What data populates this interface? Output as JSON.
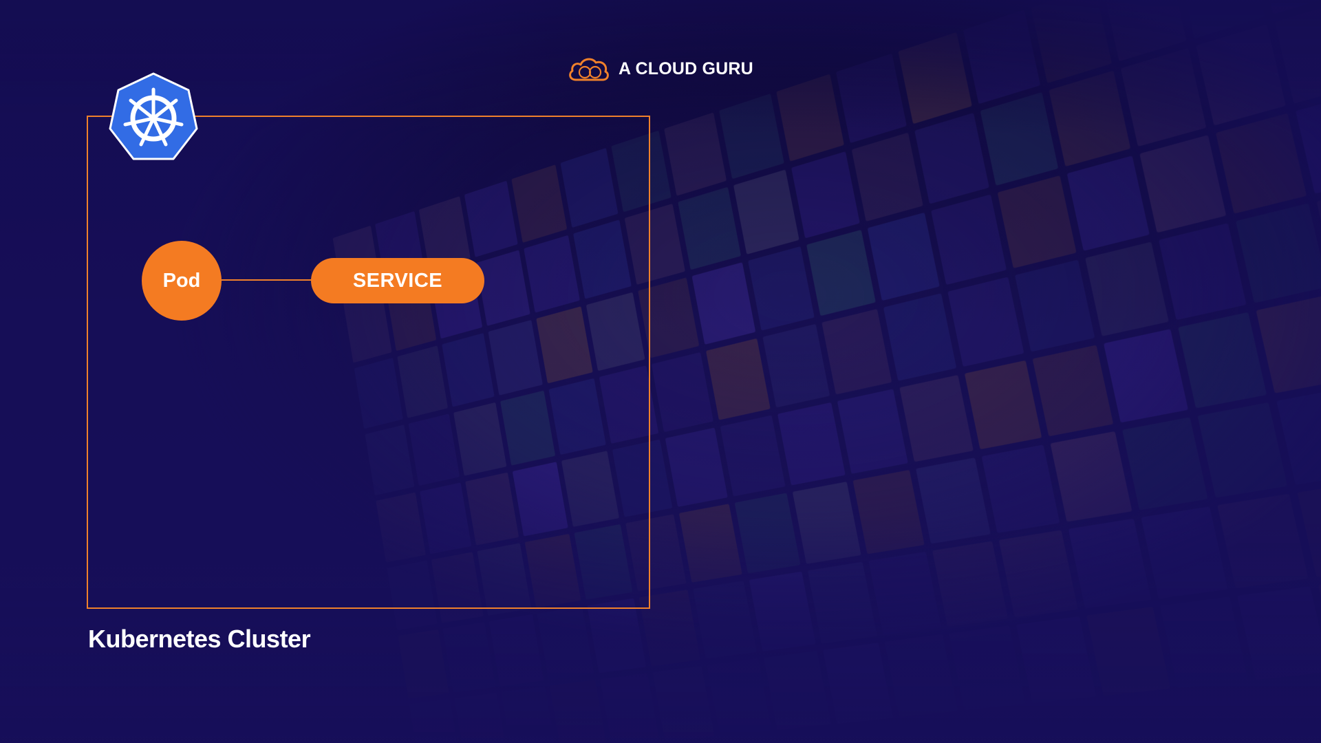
{
  "brand": {
    "name": "A CLOUD GURU",
    "logo_icon": "cloud-logo-icon",
    "accent_color": "#f0812b"
  },
  "diagram": {
    "cluster": {
      "label": "Kubernetes Cluster",
      "logo_icon": "kubernetes-helm-icon",
      "border_color": "#f0812b",
      "logo_color": "#326ce5"
    },
    "nodes": [
      {
        "id": "pod",
        "label": "Pod",
        "shape": "circle",
        "color": "#f47b22"
      },
      {
        "id": "service",
        "label": "SERVICE",
        "shape": "pill",
        "color": "#f47b22"
      }
    ],
    "edges": [
      {
        "from": "pod",
        "to": "service",
        "style": "line-with-arrow"
      }
    ]
  },
  "background": {
    "color_top": "#0d0833",
    "color_bottom": "#1d1460"
  }
}
